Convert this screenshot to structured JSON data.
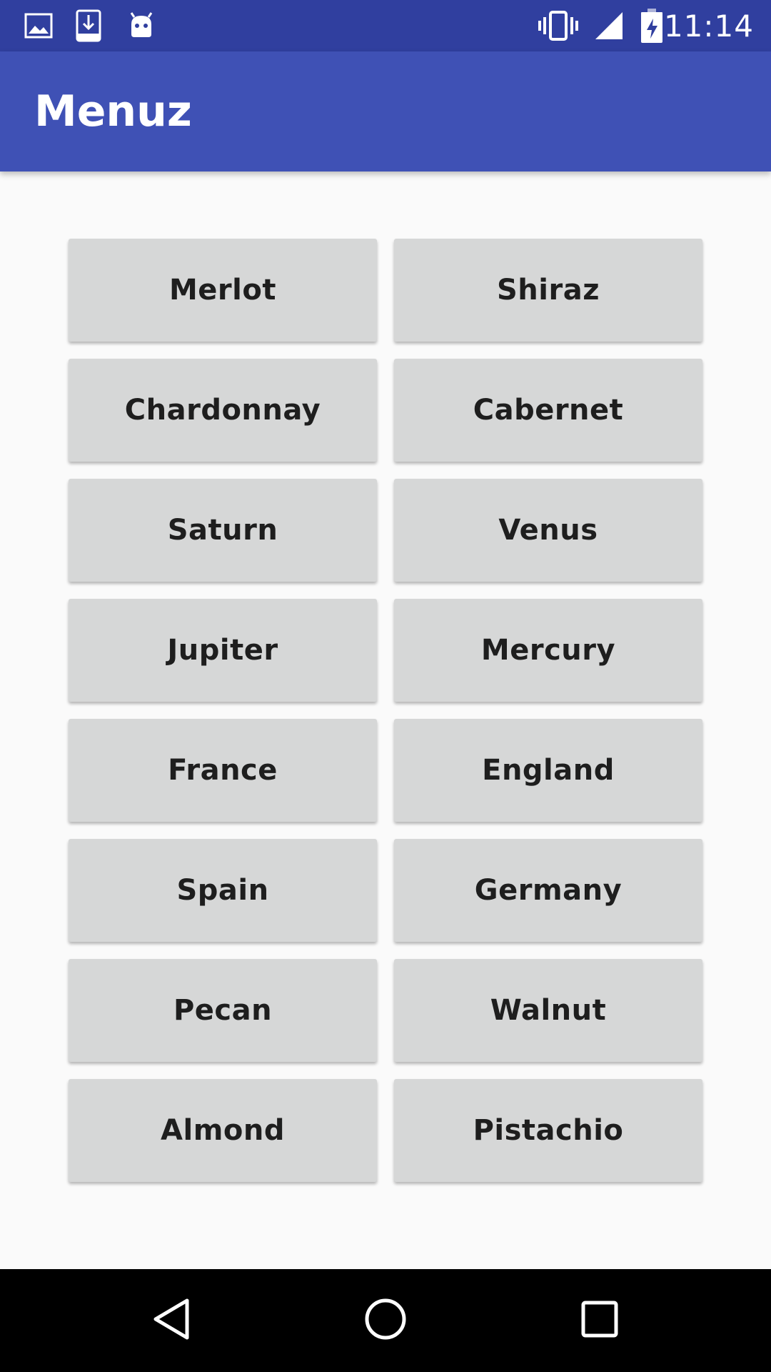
{
  "status_bar": {
    "time": "11:14",
    "icons": [
      "image-icon",
      "download-icon",
      "android-icon",
      "vibrate-icon",
      "signal-icon",
      "battery-charging-icon"
    ]
  },
  "app_bar": {
    "title": "Menuz"
  },
  "menu": {
    "items": [
      {
        "label": "Merlot"
      },
      {
        "label": "Shiraz"
      },
      {
        "label": "Chardonnay"
      },
      {
        "label": "Cabernet"
      },
      {
        "label": "Saturn"
      },
      {
        "label": "Venus"
      },
      {
        "label": "Jupiter"
      },
      {
        "label": "Mercury"
      },
      {
        "label": "France"
      },
      {
        "label": "England"
      },
      {
        "label": "Spain"
      },
      {
        "label": "Germany"
      },
      {
        "label": "Pecan"
      },
      {
        "label": "Walnut"
      },
      {
        "label": "Almond"
      },
      {
        "label": "Pistachio"
      }
    ]
  },
  "nav_bar": {
    "icons": [
      "back-icon",
      "home-icon",
      "recents-icon"
    ]
  },
  "colors": {
    "status_bar": "#303F9F",
    "app_bar": "#3F51B5",
    "button_bg": "#D6D7D7",
    "background": "#FAFAFA"
  }
}
